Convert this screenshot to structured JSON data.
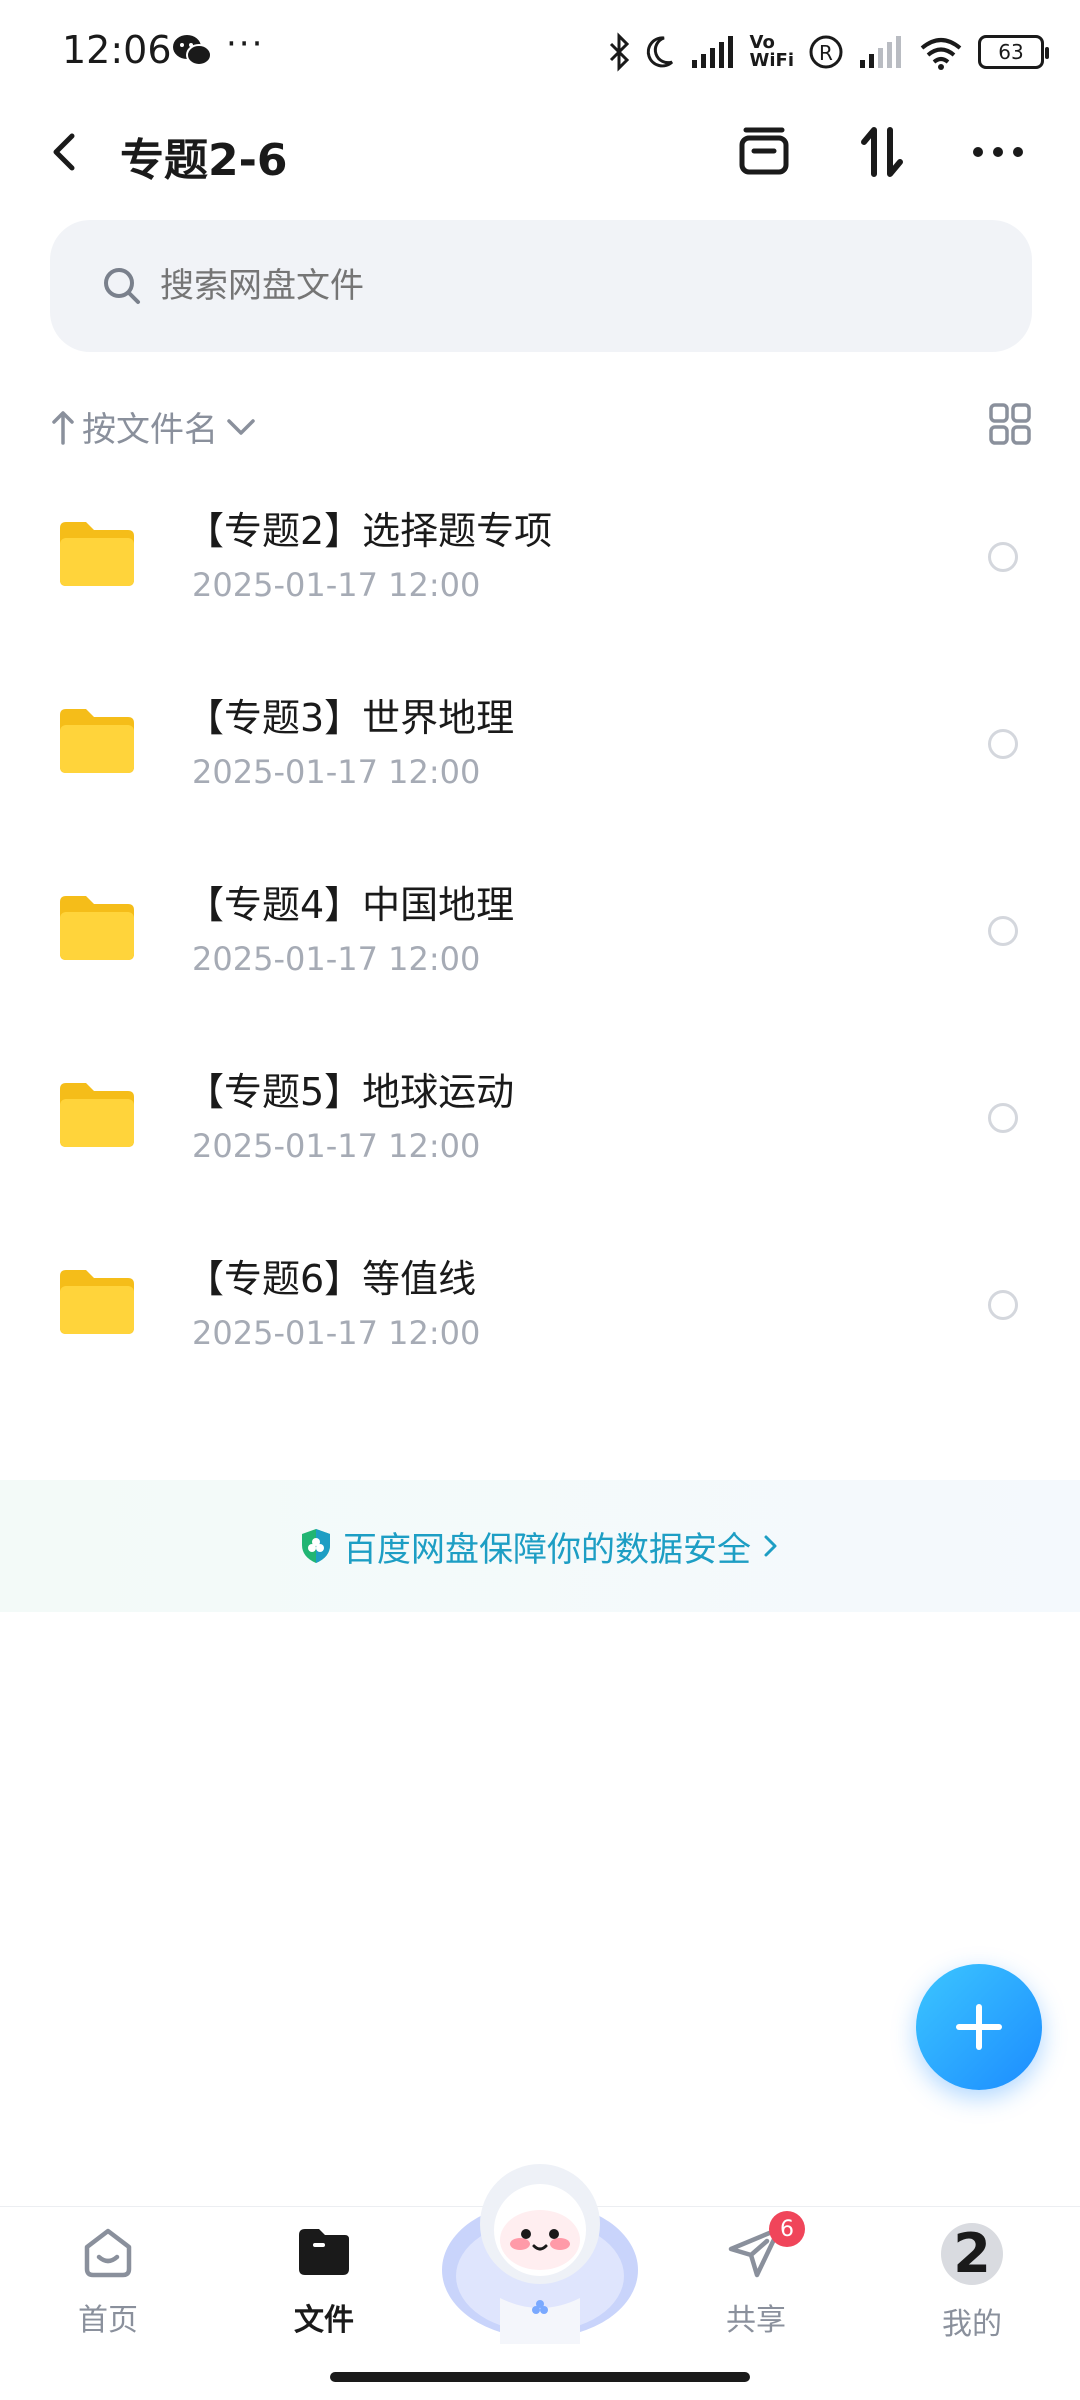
{
  "status_bar": {
    "time": "12:06",
    "dots": "···",
    "vo_wifi_top": "Vo",
    "vo_wifi_bottom": "WiFi",
    "battery": "63"
  },
  "header": {
    "title": "专题2-6"
  },
  "search": {
    "placeholder": "搜索网盘文件"
  },
  "sort": {
    "label": "按文件名"
  },
  "files": [
    {
      "name": "【专题2】选择题专项",
      "date": "2025-01-17  12:00"
    },
    {
      "name": "【专题3】世界地理",
      "date": "2025-01-17  12:00"
    },
    {
      "name": "【专题4】中国地理",
      "date": "2025-01-17  12:00"
    },
    {
      "name": "【专题5】地球运动",
      "date": "2025-01-17  12:00"
    },
    {
      "name": "【专题6】等值线",
      "date": "2025-01-17  12:00"
    }
  ],
  "security_banner": {
    "text": "百度网盘保障你的数据安全"
  },
  "bottom_nav": {
    "home": "首页",
    "files": "文件",
    "share": "共享",
    "share_badge": "6",
    "mine": "我的",
    "mine_avatar_text": "2"
  },
  "colors": {
    "accent": "#1c8cff",
    "folder": "#ffd43b",
    "security_text": "#1d9ec4",
    "badge": "#f0455a"
  },
  "icons": [
    "back-icon",
    "archive-icon",
    "sort-icon",
    "more-icon",
    "search-icon",
    "grid-view-icon",
    "folder-icon",
    "shield-icon",
    "plus-icon",
    "home-icon",
    "files-icon",
    "share-icon"
  ]
}
